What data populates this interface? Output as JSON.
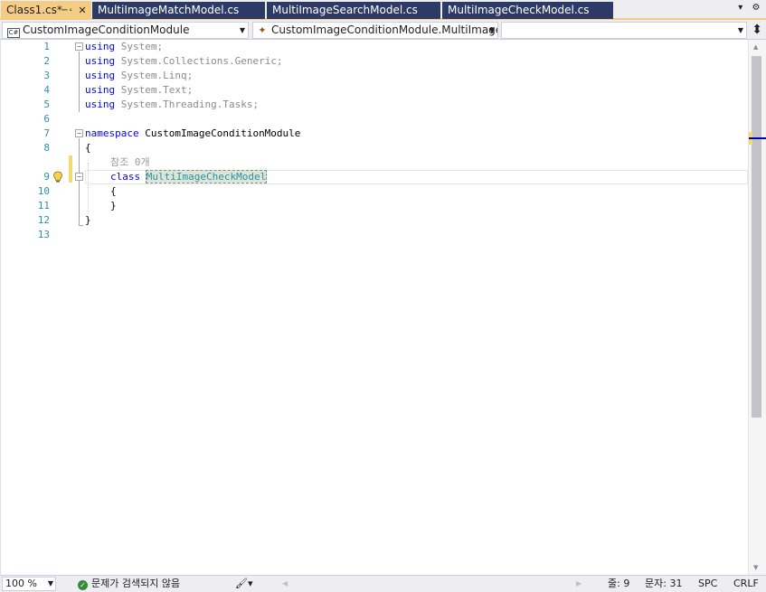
{
  "tabs": [
    {
      "label": "Class1.cs*",
      "active": true
    },
    {
      "label": "MultiImageMatchModel.cs",
      "active": false
    },
    {
      "label": "MultiImageSearchModel.cs",
      "active": false
    },
    {
      "label": "MultiImageCheckModel.cs",
      "active": false
    }
  ],
  "tab_icons": {
    "pin": "pin-icon",
    "close": "close-icon",
    "dropdown": "chevron-down-icon",
    "settings": "gear-icon"
  },
  "navbar": {
    "project_combo": "CustomImageConditionModule",
    "type_combo": "CustomImageConditionModule.MultiImageC",
    "member_combo": "",
    "project_icon_label": "C#"
  },
  "lines": [
    {
      "n": "1",
      "text": "using System;"
    },
    {
      "n": "2",
      "text": "using System.Collections.Generic;"
    },
    {
      "n": "3",
      "text": "using System.Linq;"
    },
    {
      "n": "4",
      "text": "using System.Text;"
    },
    {
      "n": "5",
      "text": "using System.Threading.Tasks;"
    },
    {
      "n": "6",
      "text": ""
    },
    {
      "n": "7",
      "text": "namespace CustomImageConditionModule"
    },
    {
      "n": "8",
      "text": "{"
    },
    {
      "n": "9",
      "text": "class MultiImageCheckModel"
    },
    {
      "n": "10",
      "text": "{"
    },
    {
      "n": "11",
      "text": "}"
    },
    {
      "n": "12",
      "text": "}"
    },
    {
      "n": "13",
      "text": ""
    }
  ],
  "code": {
    "using_kw": "using",
    "ns_1": "System;",
    "ns_2": "System.Collections.Generic;",
    "ns_3": "System.Linq;",
    "ns_4": "System.Text;",
    "ns_5": "System.Threading.Tasks;",
    "namespace_kw": "namespace",
    "namespace_name": "CustomImageConditionModule",
    "open_brace": "{",
    "close_brace": "}",
    "codelens": "참조 0개",
    "class_kw": "class",
    "class_name": "MultiImageCheckModel"
  },
  "status": {
    "zoom": "100 %",
    "issues": "문제가 검색되지 않음",
    "line": "줄: 9",
    "col": "문자: 31",
    "whitespace": "SPC",
    "eol": "CRLF"
  },
  "colors": {
    "keyword": "#0000ff",
    "type": "#2b91af",
    "line_number": "#2b91af",
    "active_tab": "#f5cc84",
    "inactive_tab": "#2c3a66",
    "change_marker": "#f2dc70"
  }
}
